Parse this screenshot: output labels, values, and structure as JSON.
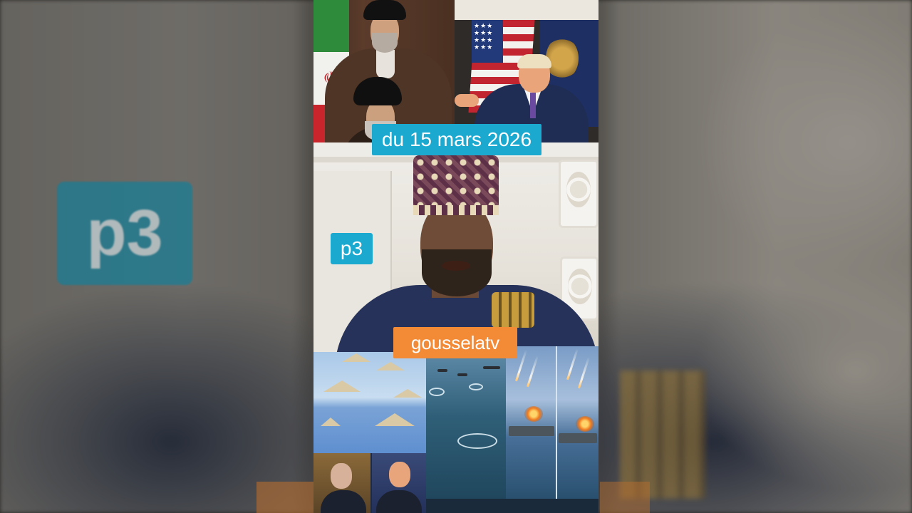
{
  "overlays": {
    "date_caption": "du 15 mars 2026",
    "part_label": "p3",
    "channel_label": "gousselatv",
    "background_part_label": "p3"
  },
  "colors": {
    "caption_bg": "#1ba9d0",
    "channel_bg": "#f28a36",
    "caption_text": "#ffffff"
  },
  "panels": [
    {
      "name": "clerics-panel",
      "icon": "iranian-flag-icon"
    },
    {
      "name": "podium-panel",
      "icon": "us-flag-icon"
    },
    {
      "name": "speaker-panel"
    },
    {
      "name": "drones-panel"
    },
    {
      "name": "ships-panel"
    },
    {
      "name": "carriers-panel"
    },
    {
      "name": "portraits-panel"
    }
  ]
}
